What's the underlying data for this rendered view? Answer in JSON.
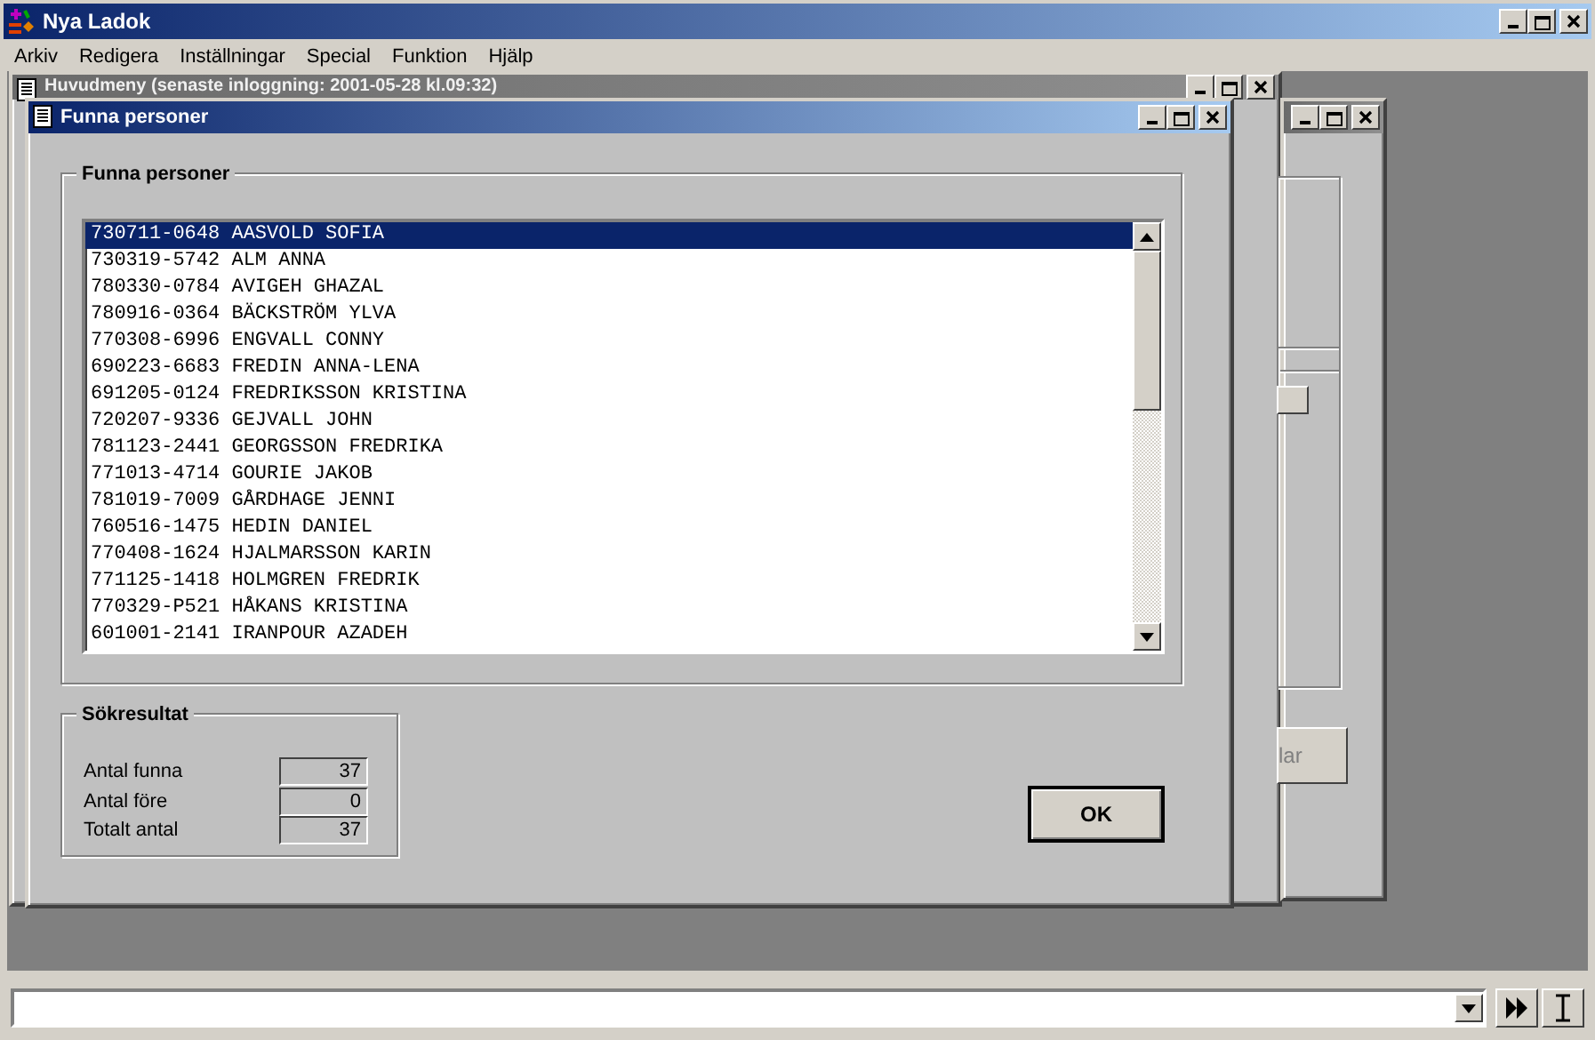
{
  "app": {
    "title": "Nya Ladok",
    "menu": [
      "Arkiv",
      "Redigera",
      "Inställningar",
      "Special",
      "Funktion",
      "Hjälp"
    ]
  },
  "background_window": {
    "title": "Huvudmeny  (senaste inloggning: 2001-05-28 kl.09:32)"
  },
  "side_window": {
    "button_label": "lar"
  },
  "dialog": {
    "title": "Funna personer",
    "group_title": "Funna personer",
    "persons": [
      {
        "id": "730711-0648",
        "name": "AASVOLD SOFIA",
        "selected": true
      },
      {
        "id": "730319-5742",
        "name": "ALM ANNA",
        "selected": false
      },
      {
        "id": "780330-0784",
        "name": "AVIGEH GHAZAL",
        "selected": false
      },
      {
        "id": "780916-0364",
        "name": "BÄCKSTRÖM YLVA",
        "selected": false
      },
      {
        "id": "770308-6996",
        "name": "ENGVALL CONNY",
        "selected": false
      },
      {
        "id": "690223-6683",
        "name": "FREDIN ANNA-LENA",
        "selected": false
      },
      {
        "id": "691205-0124",
        "name": "FREDRIKSSON KRISTINA",
        "selected": false
      },
      {
        "id": "720207-9336",
        "name": "GEJVALL JOHN",
        "selected": false
      },
      {
        "id": "781123-2441",
        "name": "GEORGSSON FREDRIKA",
        "selected": false
      },
      {
        "id": "771013-4714",
        "name": "GOURIE JAKOB",
        "selected": false
      },
      {
        "id": "781019-7009",
        "name": "GÅRDHAGE JENNI",
        "selected": false
      },
      {
        "id": "760516-1475",
        "name": "HEDIN DANIEL",
        "selected": false
      },
      {
        "id": "770408-1624",
        "name": "HJALMARSSON KARIN",
        "selected": false
      },
      {
        "id": "771125-1418",
        "name": "HOLMGREN FREDRIK",
        "selected": false
      },
      {
        "id": "770329-P521",
        "name": "HÅKANS KRISTINA",
        "selected": false
      },
      {
        "id": "601001-2141",
        "name": "IRANPOUR AZADEH",
        "selected": false
      }
    ],
    "results_title": "Sökresultat",
    "results": [
      {
        "label": "Antal funna",
        "value": "37"
      },
      {
        "label": "Antal före",
        "value": "0"
      },
      {
        "label": "Totalt antal",
        "value": "37"
      }
    ],
    "ok_button": "OK"
  }
}
